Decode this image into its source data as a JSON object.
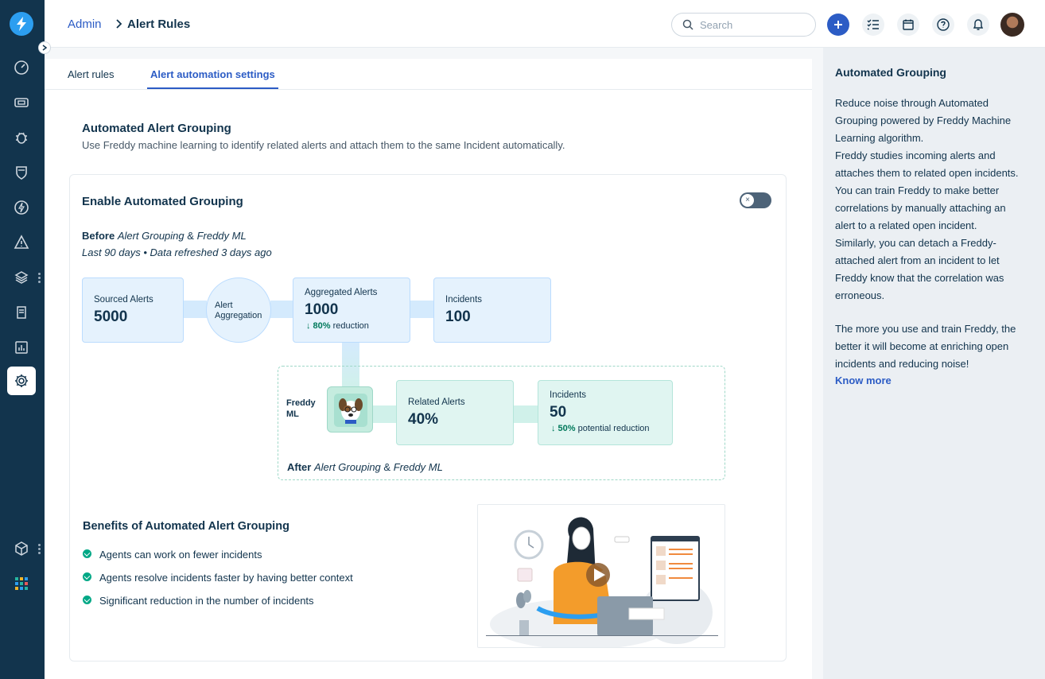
{
  "header": {
    "breadcrumb_admin": "Admin",
    "breadcrumb_current": "Alert Rules",
    "search_placeholder": "Search"
  },
  "tabs": [
    {
      "label": "Alert rules",
      "active": false
    },
    {
      "label": "Alert automation settings",
      "active": true
    }
  ],
  "section": {
    "title": "Automated Alert Grouping",
    "description": "Use Freddy machine learning to identify related alerts and attach them to the same Incident automatically."
  },
  "card": {
    "title": "Enable Automated Grouping",
    "toggle_on": false,
    "toggle_glyph": "×",
    "before_bold": "Before",
    "before_italic": "Alert Grouping",
    "before_amp": "&",
    "before_italic2": "Freddy ML",
    "refresh": "Last 90 days • Data refreshed 3 days ago",
    "flow": {
      "sourced_label": "Sourced Alerts",
      "sourced_value": "5000",
      "aggregation_label_1": "Alert",
      "aggregation_label_2": "Aggregation",
      "aggregated_label": "Aggregated Alerts",
      "aggregated_value": "1000",
      "aggregated_pct": "↓ 80%",
      "aggregated_sub": "reduction",
      "incidents_label": "Incidents",
      "incidents_value": "100"
    },
    "after": {
      "freddy_label_1": "Freddy",
      "freddy_label_2": "ML",
      "related_label": "Related Alerts",
      "related_value": "40%",
      "incidents_label": "Incidents",
      "incidents_value": "50",
      "incidents_pct": "↓ 50%",
      "incidents_sub": "potential reduction",
      "after_bold": "After",
      "after_italic": "Alert Grouping",
      "after_amp": "&",
      "after_italic2": "Freddy ML"
    },
    "benefits_title": "Benefits of Automated Alert Grouping",
    "benefits": [
      "Agents can work on fewer incidents",
      "Agents resolve incidents faster by having better context",
      "Significant reduction in the number of incidents"
    ]
  },
  "side_panel": {
    "title": "Automated Grouping",
    "para1_lines": [
      "Reduce noise through Automated",
      "Grouping powered by Freddy Machine",
      "Learning algorithm.",
      "Freddy studies incoming alerts and",
      "attaches them to related open incidents.",
      "You can train Freddy to make better",
      "correlations by manually attaching an",
      "alert to a related open incident.",
      "Similarly, you can detach a Freddy-",
      "attached alert from an incident to let",
      "Freddy know that the correlation was",
      "erroneous."
    ],
    "para2_lines": [
      "The more you use and train Freddy, the",
      "better it will become at enriching open",
      "incidents and reducing noise!"
    ],
    "link": "Know more"
  },
  "colors": {
    "rail": "#12344d",
    "accent": "#2c5cc5",
    "blue_box": "#e5f2fd",
    "green_box": "#e0f5f1",
    "success": "#00a886"
  },
  "icons": [
    "freshservice-logo-icon",
    "expand-chevron-icon",
    "dashboard-icon",
    "tickets-icon",
    "problems-bug-icon",
    "changes-shield-icon",
    "releases-bolt-icon",
    "alerts-warning-icon",
    "assets-layers-icon",
    "solutions-book-icon",
    "analytics-icon",
    "admin-gear-icon",
    "apps-cube-icon",
    "app-grid-icon",
    "search-icon",
    "plus-icon",
    "todo-list-icon",
    "calendar-icon",
    "help-icon",
    "bell-icon"
  ]
}
